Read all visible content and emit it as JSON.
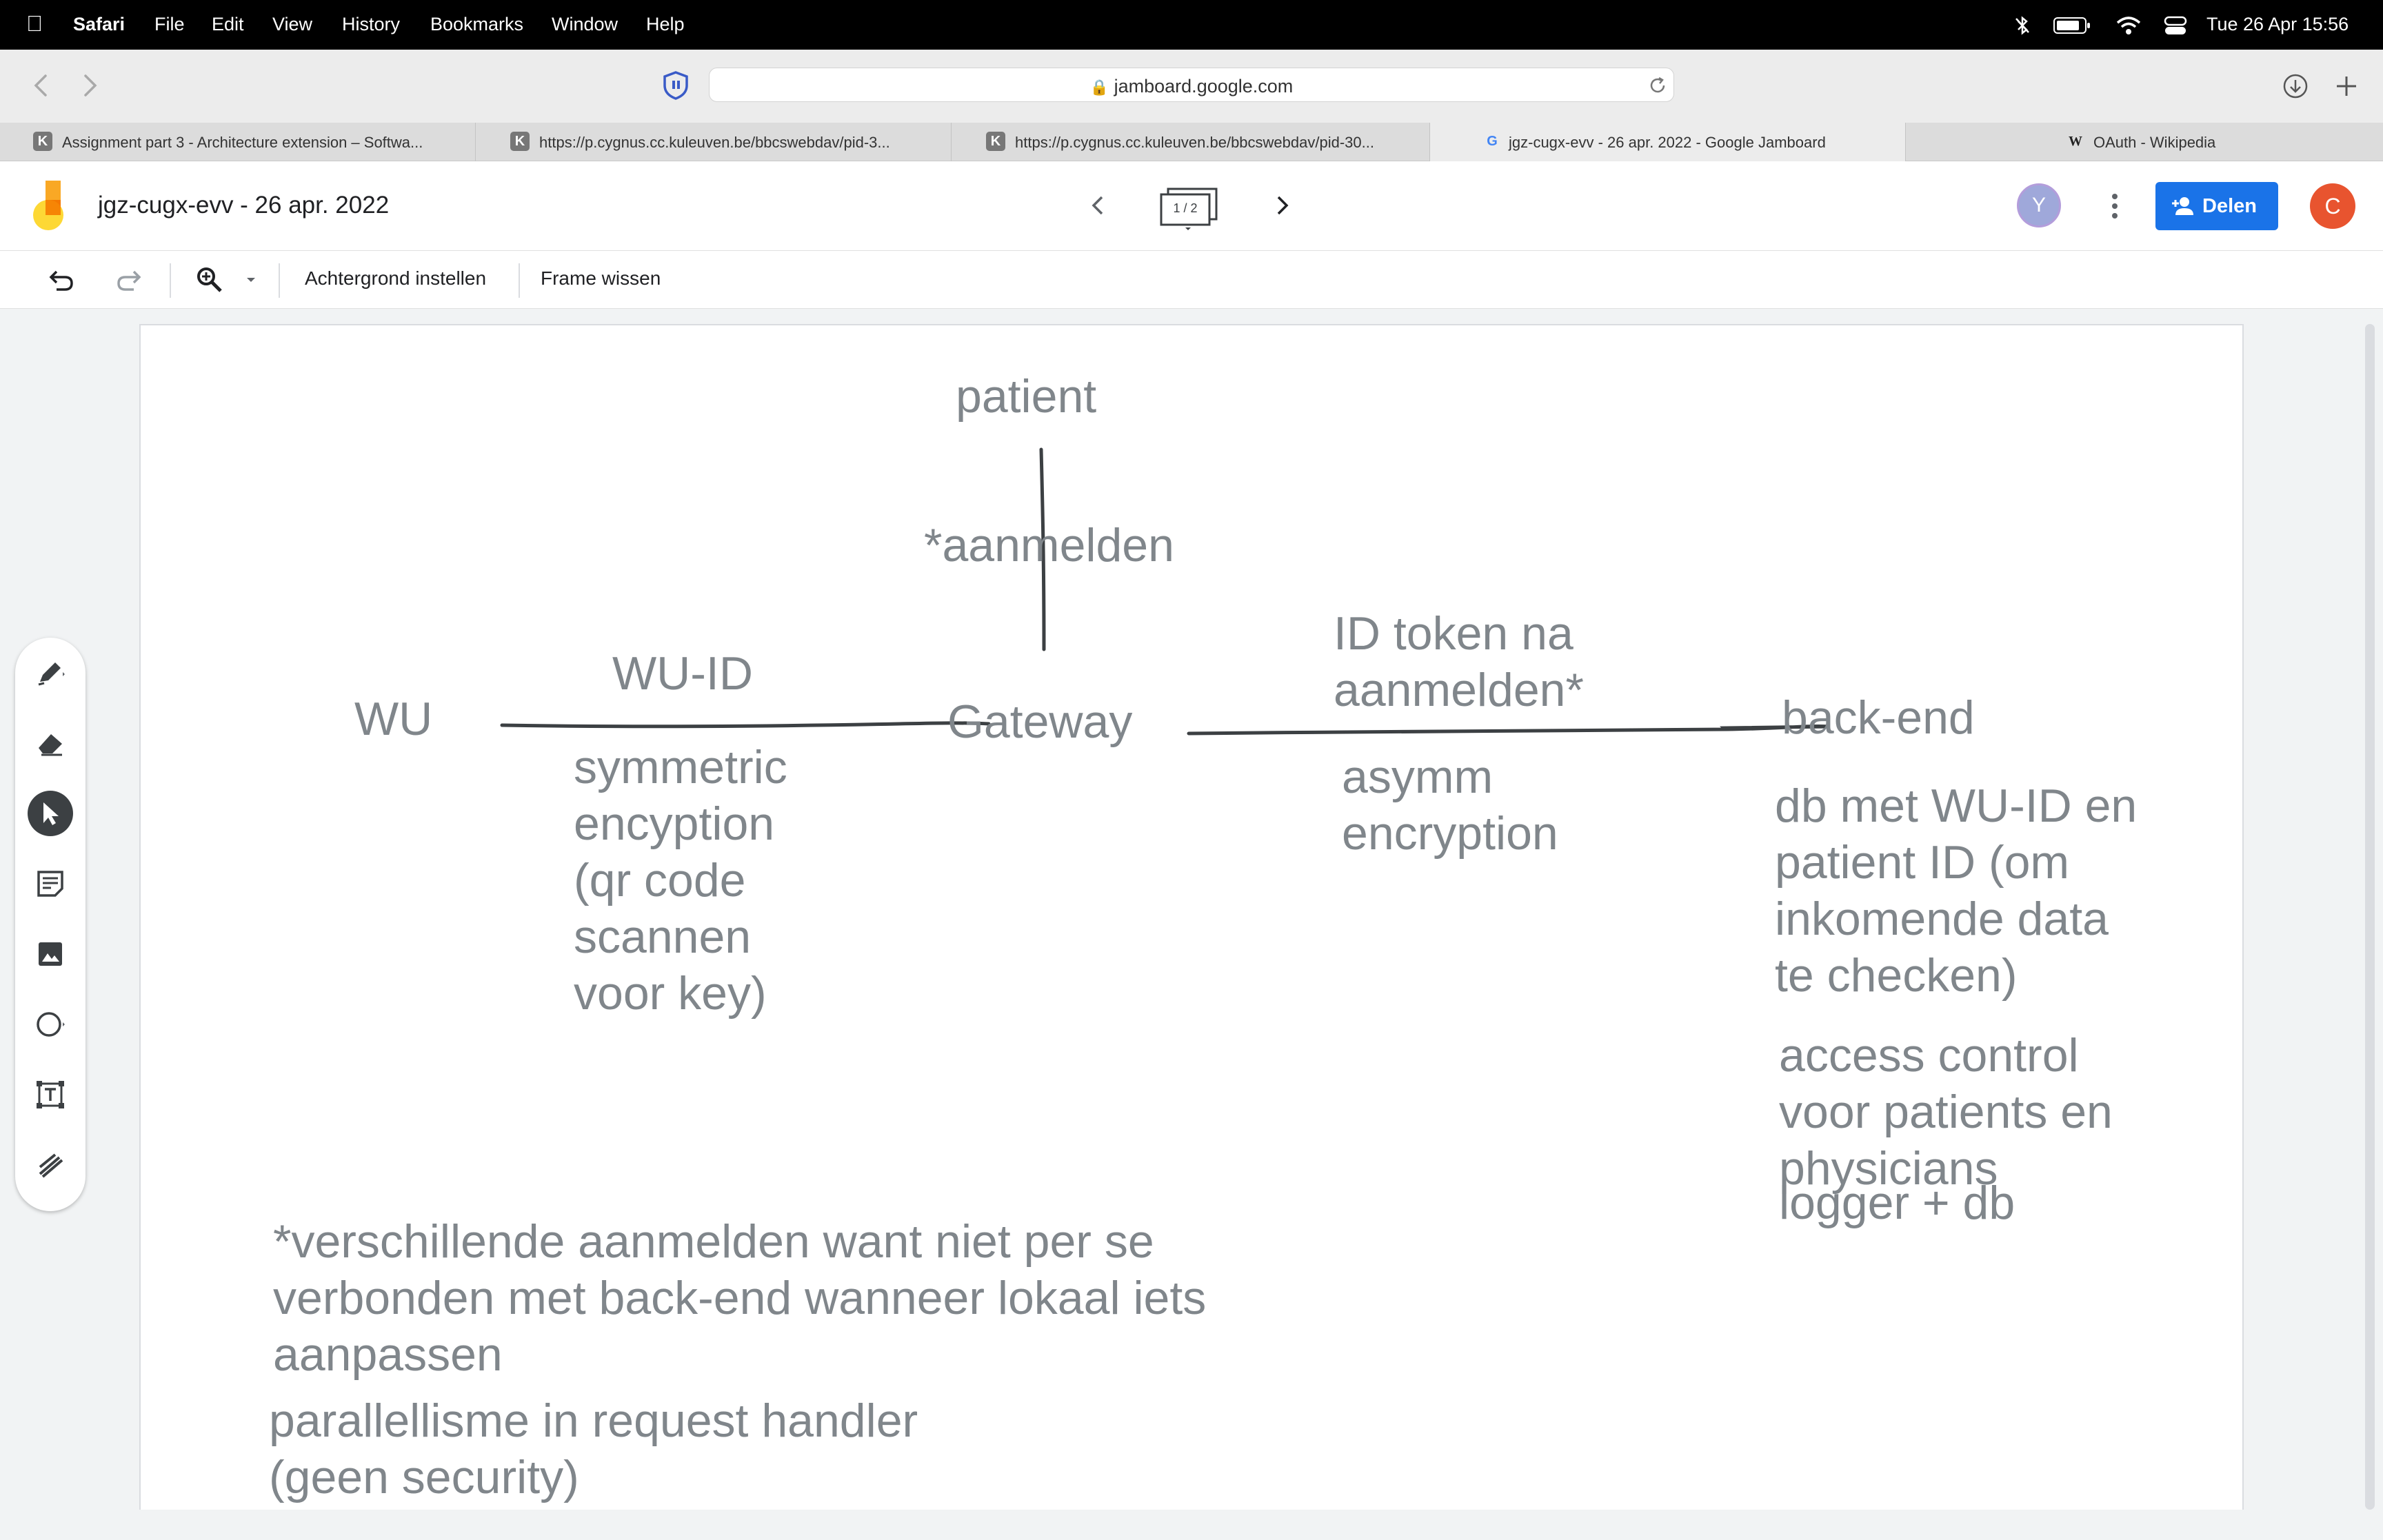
{
  "menubar": {
    "app": "Safari",
    "items": [
      "File",
      "Edit",
      "View",
      "History",
      "Bookmarks",
      "Window",
      "Help"
    ],
    "datetime": "Tue 26 Apr  15:56"
  },
  "browser": {
    "url": "jamboard.google.com",
    "tabs": [
      {
        "label": "Assignment part 3 - Architecture extension – Softwa...",
        "favicon": "K"
      },
      {
        "label": "https://p.cygnus.cc.kuleuven.be/bbcswebdav/pid-3...",
        "favicon": "K"
      },
      {
        "label": "https://p.cygnus.cc.kuleuven.be/bbcswebdav/pid-30...",
        "favicon": "K"
      },
      {
        "label": "jgz-cugx-evv - 26 apr. 2022 - Google Jamboard",
        "favicon": "G"
      },
      {
        "label": "OAuth - Wikipedia",
        "favicon": "W"
      }
    ]
  },
  "jamboard": {
    "title": "jgz-cugx-evv - 26 apr. 2022",
    "frame_indicator": "1 / 2",
    "share_label": "Delen",
    "avatar_y": "Y",
    "avatar_c": "C",
    "toolbar": {
      "background_label": "Achtergrond instellen",
      "clear_label": "Frame wissen"
    }
  },
  "board": {
    "patient": "patient",
    "aanmelden": "*aanmelden",
    "wu_id": "WU-ID",
    "wu": "WU",
    "gateway": "Gateway",
    "id_token": "ID token na\naanmelden*",
    "backend": "back-end",
    "symmetric": "symmetric\nencyption\n(qr code\nscannen\nvoor key)",
    "asymm": "asymm\nencryption",
    "db_note": "db met WU-ID en\npatient ID (om\ninkomende data\nte checken)",
    "access_control": "access control\nvoor patients en\nphysicians",
    "logger": "logger + db",
    "footnote": "*verschillende aanmelden want niet per se\nverbonden met back-end wanneer lokaal iets\naanpassen",
    "parallellisme": "parallellisme in request handler\n(geen security)"
  }
}
